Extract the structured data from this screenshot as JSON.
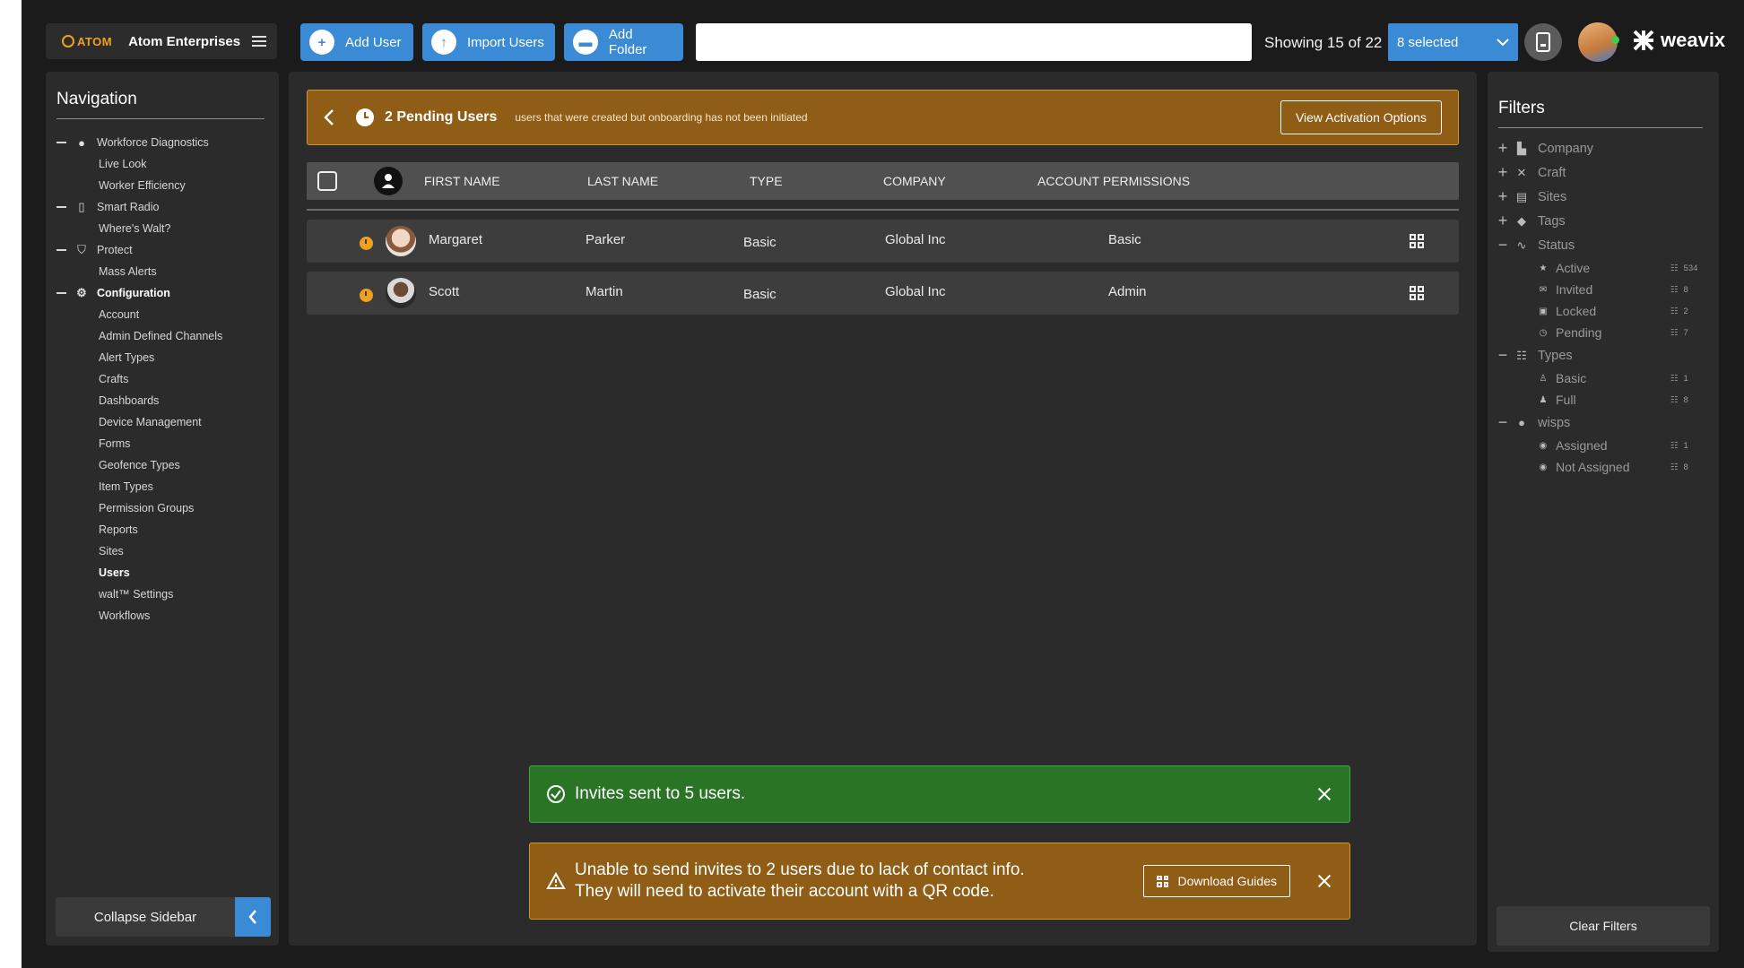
{
  "brand": {
    "logo_text": "ATOM",
    "company": "Atom Enterprises"
  },
  "toolbar": {
    "add_user": "Add User",
    "import_users": "Import Users",
    "add_folder": "Add Folder",
    "search_value": "",
    "showing": "Showing 15 of 22",
    "selected": "8 selected"
  },
  "header_right": {
    "logo_text": "weavix"
  },
  "sidebar": {
    "title": "Navigation",
    "items": [
      {
        "label": "Workforce Diagnostics",
        "kind": "parent",
        "icon": "person-icon"
      },
      {
        "label": "Live Look",
        "kind": "child"
      },
      {
        "label": "Worker Efficiency",
        "kind": "child"
      },
      {
        "label": "Smart Radio",
        "kind": "parent",
        "icon": "radio-icon"
      },
      {
        "label": "Where's Walt?",
        "kind": "child"
      },
      {
        "label": "Protect",
        "kind": "parent",
        "icon": "shield-icon"
      },
      {
        "label": "Mass Alerts",
        "kind": "child"
      },
      {
        "label": "Configuration",
        "kind": "parent",
        "icon": "gear-icon",
        "bold": true
      },
      {
        "label": "Account",
        "kind": "child"
      },
      {
        "label": "Admin Defined Channels",
        "kind": "child"
      },
      {
        "label": "Alert Types",
        "kind": "child"
      },
      {
        "label": "Crafts",
        "kind": "child"
      },
      {
        "label": "Dashboards",
        "kind": "child"
      },
      {
        "label": "Device Management",
        "kind": "child"
      },
      {
        "label": "Forms",
        "kind": "child"
      },
      {
        "label": "Geofence Types",
        "kind": "child"
      },
      {
        "label": "Item Types",
        "kind": "child"
      },
      {
        "label": "Permission Groups",
        "kind": "child"
      },
      {
        "label": "Reports",
        "kind": "child"
      },
      {
        "label": "Sites",
        "kind": "child"
      },
      {
        "label": "Users",
        "kind": "child",
        "bold": true
      },
      {
        "label": "walt™ Settings",
        "kind": "child"
      },
      {
        "label": "Workflows",
        "kind": "child"
      }
    ],
    "collapse_label": "Collapse Sidebar"
  },
  "banner": {
    "title": "2 Pending Users",
    "description": "users that were created but onboarding has not been initiated",
    "action": "View Activation Options"
  },
  "table": {
    "columns": [
      "FIRST NAME",
      "LAST NAME",
      "TYPE",
      "COMPANY",
      "ACCOUNT PERMISSIONS"
    ],
    "rows": [
      {
        "first": "Margaret",
        "last": "Parker",
        "type": "Basic",
        "company": "Global Inc",
        "permissions": "Basic"
      },
      {
        "first": "Scott",
        "last": "Martin",
        "type": "Basic",
        "company": "Global Inc",
        "permissions": "Admin"
      }
    ]
  },
  "toasts": {
    "success": "Invites sent to 5 users.",
    "warning_line1": "Unable to send invites to 2 users due to lack of contact info.",
    "warning_line2": "They will need to activate their account with a QR code.",
    "download_guides": "Download Guides"
  },
  "filters": {
    "title": "Filters",
    "groups": [
      {
        "label": "Company",
        "sign": "+",
        "icon": "building-icon"
      },
      {
        "label": "Craft",
        "sign": "+",
        "icon": "tools-icon"
      },
      {
        "label": "Sites",
        "sign": "+",
        "icon": "site-icon"
      },
      {
        "label": "Tags",
        "sign": "+",
        "icon": "tag-icon"
      },
      {
        "label": "Status",
        "sign": "−",
        "icon": "pulse-icon"
      },
      {
        "label": "Active",
        "sub": true,
        "icon": "star-icon",
        "count": "534"
      },
      {
        "label": "Invited",
        "sub": true,
        "icon": "mail-icon",
        "count": "8"
      },
      {
        "label": "Locked",
        "sub": true,
        "icon": "lock-icon",
        "count": "2"
      },
      {
        "label": "Pending",
        "sub": true,
        "icon": "clock-icon",
        "count": "7"
      },
      {
        "label": "Types",
        "sign": "−",
        "icon": "people-icon"
      },
      {
        "label": "Basic",
        "sub": true,
        "icon": "person-outline-icon",
        "count": "1"
      },
      {
        "label": "Full",
        "sub": true,
        "icon": "person-icon",
        "count": "8"
      },
      {
        "label": "wisps",
        "sign": "−",
        "icon": "wisp-icon"
      },
      {
        "label": "Assigned",
        "sub": true,
        "icon": "check-circle-icon",
        "count": "1"
      },
      {
        "label": "Not Assigned",
        "sub": true,
        "icon": "x-circle-icon",
        "count": "8"
      }
    ],
    "clear_label": "Clear Filters"
  },
  "colors": {
    "accent": "#3a8ad6",
    "pending": "#8f5d16",
    "success": "#2a7425",
    "background": "#1b1b1b",
    "panel": "#2b2b2b"
  }
}
